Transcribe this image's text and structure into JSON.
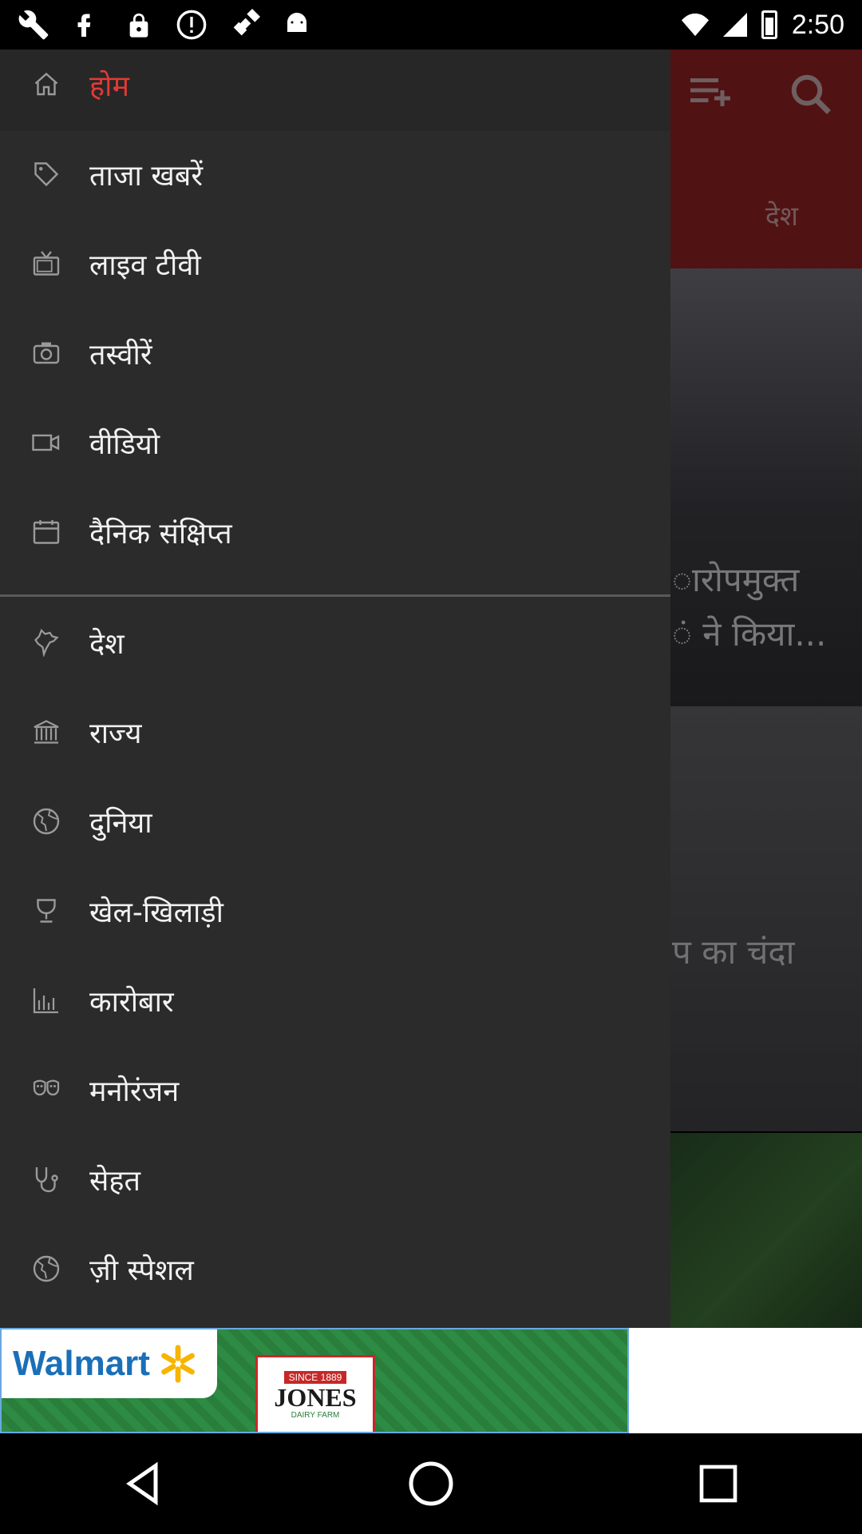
{
  "status": {
    "time": "2:50",
    "icons": [
      "wrench-icon",
      "facebook-icon",
      "lock-icon",
      "alert-icon",
      "fake-gps-icon",
      "android-icon"
    ]
  },
  "app": {
    "header_tab": "देश",
    "card1_text_line1": "ारोपमुक्त",
    "card1_text_line2": "ं ने किया...",
    "card2_text": "प का चंदा"
  },
  "drawer": {
    "items": [
      {
        "label": "होम",
        "icon": "home-icon",
        "active": true
      },
      {
        "label": "ताजा खबरें",
        "icon": "tag-icon"
      },
      {
        "label": "लाइव टीवी",
        "icon": "tv-icon"
      },
      {
        "label": "तस्वीरें",
        "icon": "camera-icon"
      },
      {
        "label": "वीडियो",
        "icon": "video-icon"
      },
      {
        "label": "दैनिक संक्षिप्त",
        "icon": "calendar-icon"
      },
      {
        "label": "देश",
        "icon": "india-map-icon"
      },
      {
        "label": "राज्य",
        "icon": "building-icon"
      },
      {
        "label": "दुनिया",
        "icon": "globe-icon"
      },
      {
        "label": "खेल-खिलाड़ी",
        "icon": "trophy-icon"
      },
      {
        "label": "कारोबार",
        "icon": "bar-chart-icon"
      },
      {
        "label": "मनोरंजन",
        "icon": "theater-masks-icon"
      },
      {
        "label": "सेहत",
        "icon": "stethoscope-icon"
      },
      {
        "label": "ज़ी स्पेशल",
        "icon": "globe-special-icon"
      }
    ]
  },
  "ad": {
    "brand": "Walmart",
    "product_top": "SINCE 1889",
    "product_name": "JONES",
    "product_sub": "DAIRY FARM"
  },
  "colors": {
    "header": "#8c1f22",
    "drawer_bg": "#2b2b2b",
    "active_label": "#e53935"
  }
}
